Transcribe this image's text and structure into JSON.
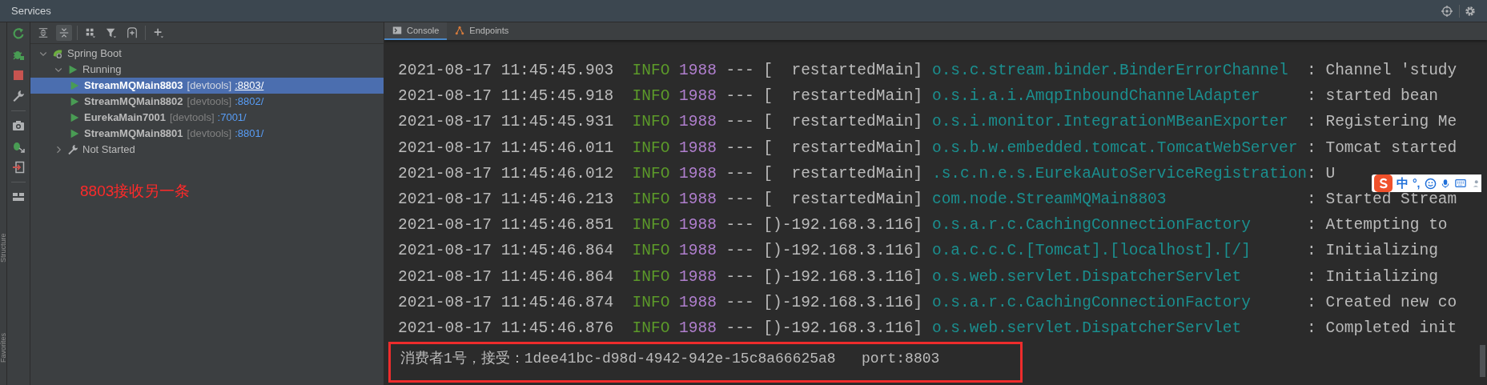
{
  "window": {
    "title": "Services"
  },
  "side_labels": [
    "Structure",
    "Favorites"
  ],
  "tree": [
    {
      "label": "Spring Boot",
      "kind": "group",
      "expanded": true,
      "selected": false,
      "children": [
        {
          "label": "Running",
          "kind": "running",
          "expanded": true,
          "selected": false,
          "children": [
            {
              "label": "StreamMQMain8803",
              "kind": "service",
              "tag": "[devtools]",
              "link": ":8803/",
              "selected": true
            },
            {
              "label": "StreamMQMain8802",
              "kind": "service",
              "tag": "[devtools]",
              "link": ":8802/",
              "selected": false
            },
            {
              "label": "EurekaMain7001",
              "kind": "service",
              "tag": "[devtools]",
              "link": ":7001/",
              "selected": false
            },
            {
              "label": "StreamMQMain8801",
              "kind": "service",
              "tag": "[devtools]",
              "link": ":8801/",
              "selected": false
            }
          ]
        },
        {
          "label": "Not Started",
          "kind": "idle",
          "expanded": false,
          "selected": false
        }
      ]
    }
  ],
  "annotation": "8803接收另一条",
  "tabs": [
    {
      "label": "Console",
      "kind": "console",
      "selected": true
    },
    {
      "label": "Endpoints",
      "kind": "endpoints",
      "selected": false
    }
  ],
  "console": {
    "lines": [
      {
        "timestamp": "2021-08-17 11:45:45.903",
        "level": "INFO",
        "pid": "1988",
        "separator": "---",
        "thread": "[  restartedMain]",
        "logger": "o.s.c.stream.binder.BinderErrorChannel",
        "message": ": Channel 'study"
      },
      {
        "timestamp": "2021-08-17 11:45:45.918",
        "level": "INFO",
        "pid": "1988",
        "separator": "---",
        "thread": "[  restartedMain]",
        "logger": "o.s.i.a.i.AmqpInboundChannelAdapter",
        "message": ": started bean"
      },
      {
        "timestamp": "2021-08-17 11:45:45.931",
        "level": "INFO",
        "pid": "1988",
        "separator": "---",
        "thread": "[  restartedMain]",
        "logger": "o.s.i.monitor.IntegrationMBeanExporter",
        "message": ": Registering Me"
      },
      {
        "timestamp": "2021-08-17 11:45:46.011",
        "level": "INFO",
        "pid": "1988",
        "separator": "---",
        "thread": "[  restartedMain]",
        "logger": "o.s.b.w.embedded.tomcat.TomcatWebServer",
        "message": ": Tomcat started"
      },
      {
        "timestamp": "2021-08-17 11:45:46.012",
        "level": "INFO",
        "pid": "1988",
        "separator": "---",
        "thread": "[  restartedMain]",
        "logger": ".s.c.n.e.s.EurekaAutoServiceRegistration",
        "message": ": U"
      },
      {
        "timestamp": "2021-08-17 11:45:46.213",
        "level": "INFO",
        "pid": "1988",
        "separator": "---",
        "thread": "[  restartedMain]",
        "logger": "com.node.StreamMQMain8803",
        "message": ": Started Stream"
      },
      {
        "timestamp": "2021-08-17 11:45:46.851",
        "level": "INFO",
        "pid": "1988",
        "separator": "---",
        "thread": "[)-192.168.3.116]",
        "logger": "o.s.a.r.c.CachingConnectionFactory",
        "message": ": Attempting to"
      },
      {
        "timestamp": "2021-08-17 11:45:46.864",
        "level": "INFO",
        "pid": "1988",
        "separator": "---",
        "thread": "[)-192.168.3.116]",
        "logger": "o.a.c.c.C.[Tomcat].[localhost].[/]",
        "message": ": Initializing"
      },
      {
        "timestamp": "2021-08-17 11:45:46.864",
        "level": "INFO",
        "pid": "1988",
        "separator": "---",
        "thread": "[)-192.168.3.116]",
        "logger": "o.s.web.servlet.DispatcherServlet",
        "message": ": Initializing"
      },
      {
        "timestamp": "2021-08-17 11:45:46.874",
        "level": "INFO",
        "pid": "1988",
        "separator": "---",
        "thread": "[)-192.168.3.116]",
        "logger": "o.s.a.r.c.CachingConnectionFactory",
        "message": ": Created new co"
      },
      {
        "timestamp": "2021-08-17 11:45:46.876",
        "level": "INFO",
        "pid": "1988",
        "separator": "---",
        "thread": "[)-192.168.3.116]",
        "logger": "o.s.web.servlet.DispatcherServlet",
        "message": ": Completed init"
      }
    ],
    "output": "消费者1号，接受：1dee41bc-d98d-4942-942e-15c8a66625a8   port:8803",
    "output_highlighted": true
  },
  "ime_toolbar": {
    "mode": "中",
    "punctuation": "°,"
  }
}
